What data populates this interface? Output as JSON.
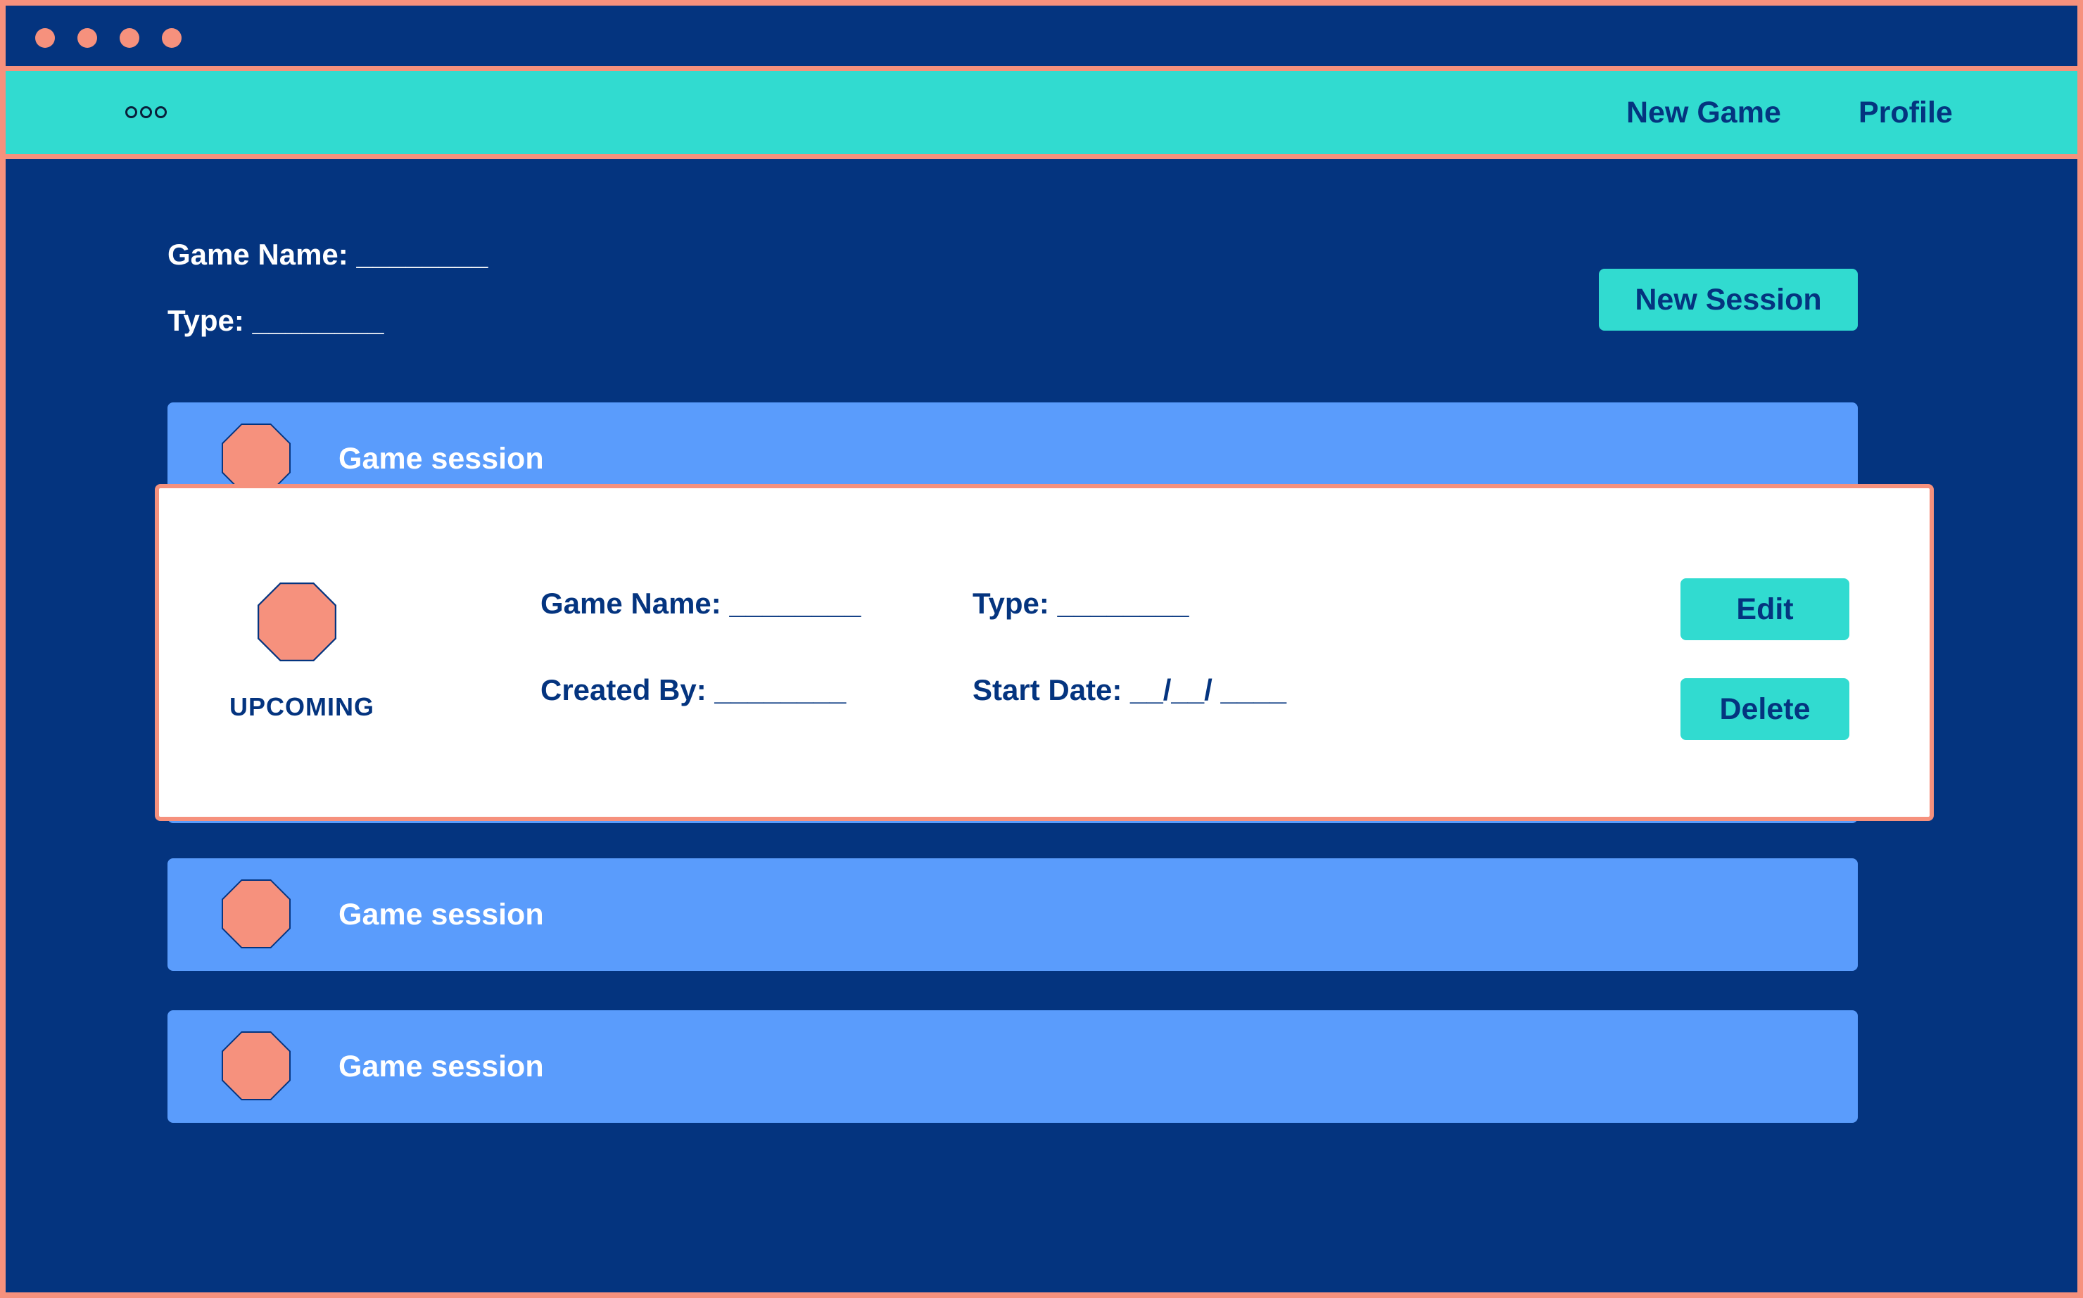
{
  "colors": {
    "background": "#04347f",
    "accent_border": "#f6917d",
    "nav_background": "#31dbd0",
    "button_background": "#31dbd0",
    "row_background": "#5a9cfc",
    "card_background": "#ffffff",
    "text_dark": "#04347f",
    "text_light": "#ffffff"
  },
  "window": {
    "controls": [
      "dot",
      "dot",
      "dot",
      "dot"
    ]
  },
  "nav": {
    "menu_icon": "more-dots-icon",
    "new_game": "New Game",
    "profile": "Profile"
  },
  "header": {
    "game_name": "Game Name: ________",
    "type": "Type: ________",
    "new_session_button": "New Session"
  },
  "sessions": [
    {
      "label": "Game session",
      "icon": "octagon-icon"
    },
    {
      "label": "Game session",
      "icon": "octagon-icon"
    },
    {
      "label": "Game session",
      "icon": "octagon-icon"
    }
  ],
  "detail_card": {
    "icon": "octagon-icon",
    "status": "UPCOMING",
    "game_name": "Game Name: ________",
    "type": "Type: ________",
    "created_by": "Created By: ________",
    "start_date": "Start Date: __/__/ ____",
    "edit_button": "Edit",
    "delete_button": "Delete"
  }
}
